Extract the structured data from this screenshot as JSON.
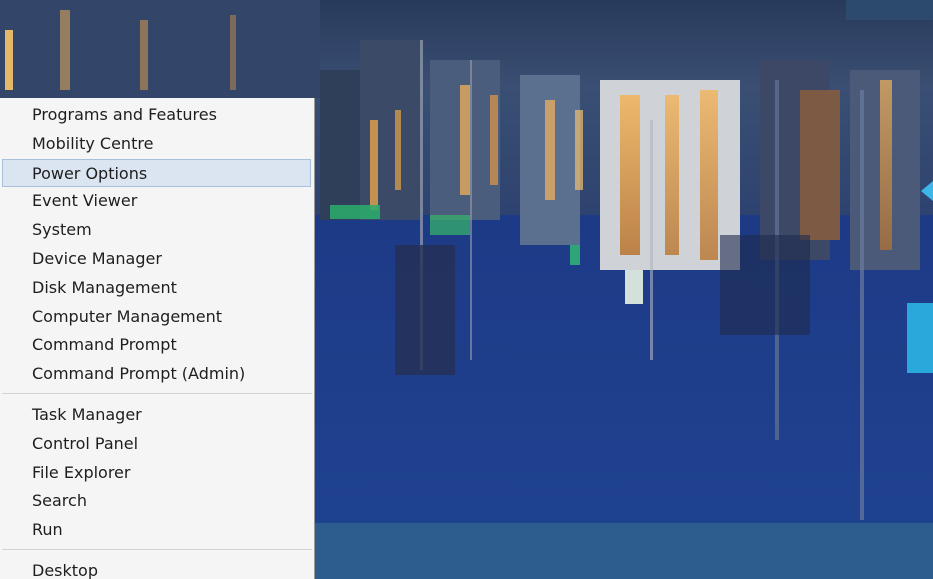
{
  "desktop": {
    "colors": {
      "water": "#203f86",
      "taskbar": "#2d5d8f",
      "charm_accent": "#29a8dc",
      "menu_background": "#f5f5f5",
      "menu_highlight": "#dbe5f1"
    }
  },
  "menu": {
    "group1": [
      {
        "label": "Programs and Features"
      },
      {
        "label": "Mobility Centre"
      },
      {
        "label": "Power Options",
        "highlighted": true
      },
      {
        "label": "Event Viewer"
      },
      {
        "label": "System"
      },
      {
        "label": "Device Manager"
      },
      {
        "label": "Disk Management"
      },
      {
        "label": "Computer Management"
      },
      {
        "label": "Command Prompt"
      },
      {
        "label": "Command Prompt (Admin)"
      }
    ],
    "group2": [
      {
        "label": "Task Manager"
      },
      {
        "label": "Control Panel"
      },
      {
        "label": "File Explorer"
      },
      {
        "label": "Search"
      },
      {
        "label": "Run"
      }
    ],
    "group3": [
      {
        "label": "Desktop"
      }
    ]
  }
}
